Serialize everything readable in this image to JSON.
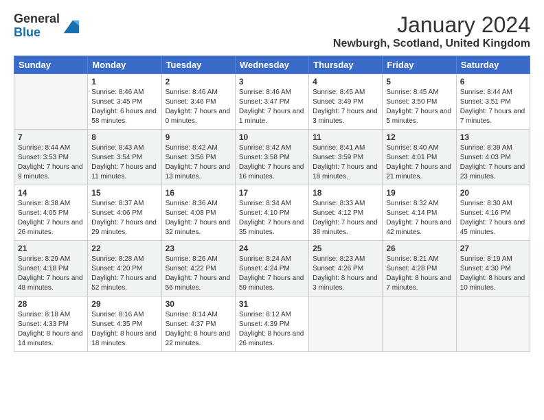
{
  "header": {
    "logo_line1": "General",
    "logo_line2": "Blue",
    "month": "January 2024",
    "location": "Newburgh, Scotland, United Kingdom"
  },
  "days_of_week": [
    "Sunday",
    "Monday",
    "Tuesday",
    "Wednesday",
    "Thursday",
    "Friday",
    "Saturday"
  ],
  "weeks": [
    [
      {
        "day": "",
        "sunrise": "",
        "sunset": "",
        "daylight": ""
      },
      {
        "day": "1",
        "sunrise": "Sunrise: 8:46 AM",
        "sunset": "Sunset: 3:45 PM",
        "daylight": "Daylight: 6 hours and 58 minutes."
      },
      {
        "day": "2",
        "sunrise": "Sunrise: 8:46 AM",
        "sunset": "Sunset: 3:46 PM",
        "daylight": "Daylight: 7 hours and 0 minutes."
      },
      {
        "day": "3",
        "sunrise": "Sunrise: 8:46 AM",
        "sunset": "Sunset: 3:47 PM",
        "daylight": "Daylight: 7 hours and 1 minute."
      },
      {
        "day": "4",
        "sunrise": "Sunrise: 8:45 AM",
        "sunset": "Sunset: 3:49 PM",
        "daylight": "Daylight: 7 hours and 3 minutes."
      },
      {
        "day": "5",
        "sunrise": "Sunrise: 8:45 AM",
        "sunset": "Sunset: 3:50 PM",
        "daylight": "Daylight: 7 hours and 5 minutes."
      },
      {
        "day": "6",
        "sunrise": "Sunrise: 8:44 AM",
        "sunset": "Sunset: 3:51 PM",
        "daylight": "Daylight: 7 hours and 7 minutes."
      }
    ],
    [
      {
        "day": "7",
        "sunrise": "Sunrise: 8:44 AM",
        "sunset": "Sunset: 3:53 PM",
        "daylight": "Daylight: 7 hours and 9 minutes."
      },
      {
        "day": "8",
        "sunrise": "Sunrise: 8:43 AM",
        "sunset": "Sunset: 3:54 PM",
        "daylight": "Daylight: 7 hours and 11 minutes."
      },
      {
        "day": "9",
        "sunrise": "Sunrise: 8:42 AM",
        "sunset": "Sunset: 3:56 PM",
        "daylight": "Daylight: 7 hours and 13 minutes."
      },
      {
        "day": "10",
        "sunrise": "Sunrise: 8:42 AM",
        "sunset": "Sunset: 3:58 PM",
        "daylight": "Daylight: 7 hours and 16 minutes."
      },
      {
        "day": "11",
        "sunrise": "Sunrise: 8:41 AM",
        "sunset": "Sunset: 3:59 PM",
        "daylight": "Daylight: 7 hours and 18 minutes."
      },
      {
        "day": "12",
        "sunrise": "Sunrise: 8:40 AM",
        "sunset": "Sunset: 4:01 PM",
        "daylight": "Daylight: 7 hours and 21 minutes."
      },
      {
        "day": "13",
        "sunrise": "Sunrise: 8:39 AM",
        "sunset": "Sunset: 4:03 PM",
        "daylight": "Daylight: 7 hours and 23 minutes."
      }
    ],
    [
      {
        "day": "14",
        "sunrise": "Sunrise: 8:38 AM",
        "sunset": "Sunset: 4:05 PM",
        "daylight": "Daylight: 7 hours and 26 minutes."
      },
      {
        "day": "15",
        "sunrise": "Sunrise: 8:37 AM",
        "sunset": "Sunset: 4:06 PM",
        "daylight": "Daylight: 7 hours and 29 minutes."
      },
      {
        "day": "16",
        "sunrise": "Sunrise: 8:36 AM",
        "sunset": "Sunset: 4:08 PM",
        "daylight": "Daylight: 7 hours and 32 minutes."
      },
      {
        "day": "17",
        "sunrise": "Sunrise: 8:34 AM",
        "sunset": "Sunset: 4:10 PM",
        "daylight": "Daylight: 7 hours and 35 minutes."
      },
      {
        "day": "18",
        "sunrise": "Sunrise: 8:33 AM",
        "sunset": "Sunset: 4:12 PM",
        "daylight": "Daylight: 7 hours and 38 minutes."
      },
      {
        "day": "19",
        "sunrise": "Sunrise: 8:32 AM",
        "sunset": "Sunset: 4:14 PM",
        "daylight": "Daylight: 7 hours and 42 minutes."
      },
      {
        "day": "20",
        "sunrise": "Sunrise: 8:30 AM",
        "sunset": "Sunset: 4:16 PM",
        "daylight": "Daylight: 7 hours and 45 minutes."
      }
    ],
    [
      {
        "day": "21",
        "sunrise": "Sunrise: 8:29 AM",
        "sunset": "Sunset: 4:18 PM",
        "daylight": "Daylight: 7 hours and 48 minutes."
      },
      {
        "day": "22",
        "sunrise": "Sunrise: 8:28 AM",
        "sunset": "Sunset: 4:20 PM",
        "daylight": "Daylight: 7 hours and 52 minutes."
      },
      {
        "day": "23",
        "sunrise": "Sunrise: 8:26 AM",
        "sunset": "Sunset: 4:22 PM",
        "daylight": "Daylight: 7 hours and 56 minutes."
      },
      {
        "day": "24",
        "sunrise": "Sunrise: 8:24 AM",
        "sunset": "Sunset: 4:24 PM",
        "daylight": "Daylight: 7 hours and 59 minutes."
      },
      {
        "day": "25",
        "sunrise": "Sunrise: 8:23 AM",
        "sunset": "Sunset: 4:26 PM",
        "daylight": "Daylight: 8 hours and 3 minutes."
      },
      {
        "day": "26",
        "sunrise": "Sunrise: 8:21 AM",
        "sunset": "Sunset: 4:28 PM",
        "daylight": "Daylight: 8 hours and 7 minutes."
      },
      {
        "day": "27",
        "sunrise": "Sunrise: 8:19 AM",
        "sunset": "Sunset: 4:30 PM",
        "daylight": "Daylight: 8 hours and 10 minutes."
      }
    ],
    [
      {
        "day": "28",
        "sunrise": "Sunrise: 8:18 AM",
        "sunset": "Sunset: 4:33 PM",
        "daylight": "Daylight: 8 hours and 14 minutes."
      },
      {
        "day": "29",
        "sunrise": "Sunrise: 8:16 AM",
        "sunset": "Sunset: 4:35 PM",
        "daylight": "Daylight: 8 hours and 18 minutes."
      },
      {
        "day": "30",
        "sunrise": "Sunrise: 8:14 AM",
        "sunset": "Sunset: 4:37 PM",
        "daylight": "Daylight: 8 hours and 22 minutes."
      },
      {
        "day": "31",
        "sunrise": "Sunrise: 8:12 AM",
        "sunset": "Sunset: 4:39 PM",
        "daylight": "Daylight: 8 hours and 26 minutes."
      },
      {
        "day": "",
        "sunrise": "",
        "sunset": "",
        "daylight": ""
      },
      {
        "day": "",
        "sunrise": "",
        "sunset": "",
        "daylight": ""
      },
      {
        "day": "",
        "sunrise": "",
        "sunset": "",
        "daylight": ""
      }
    ]
  ]
}
